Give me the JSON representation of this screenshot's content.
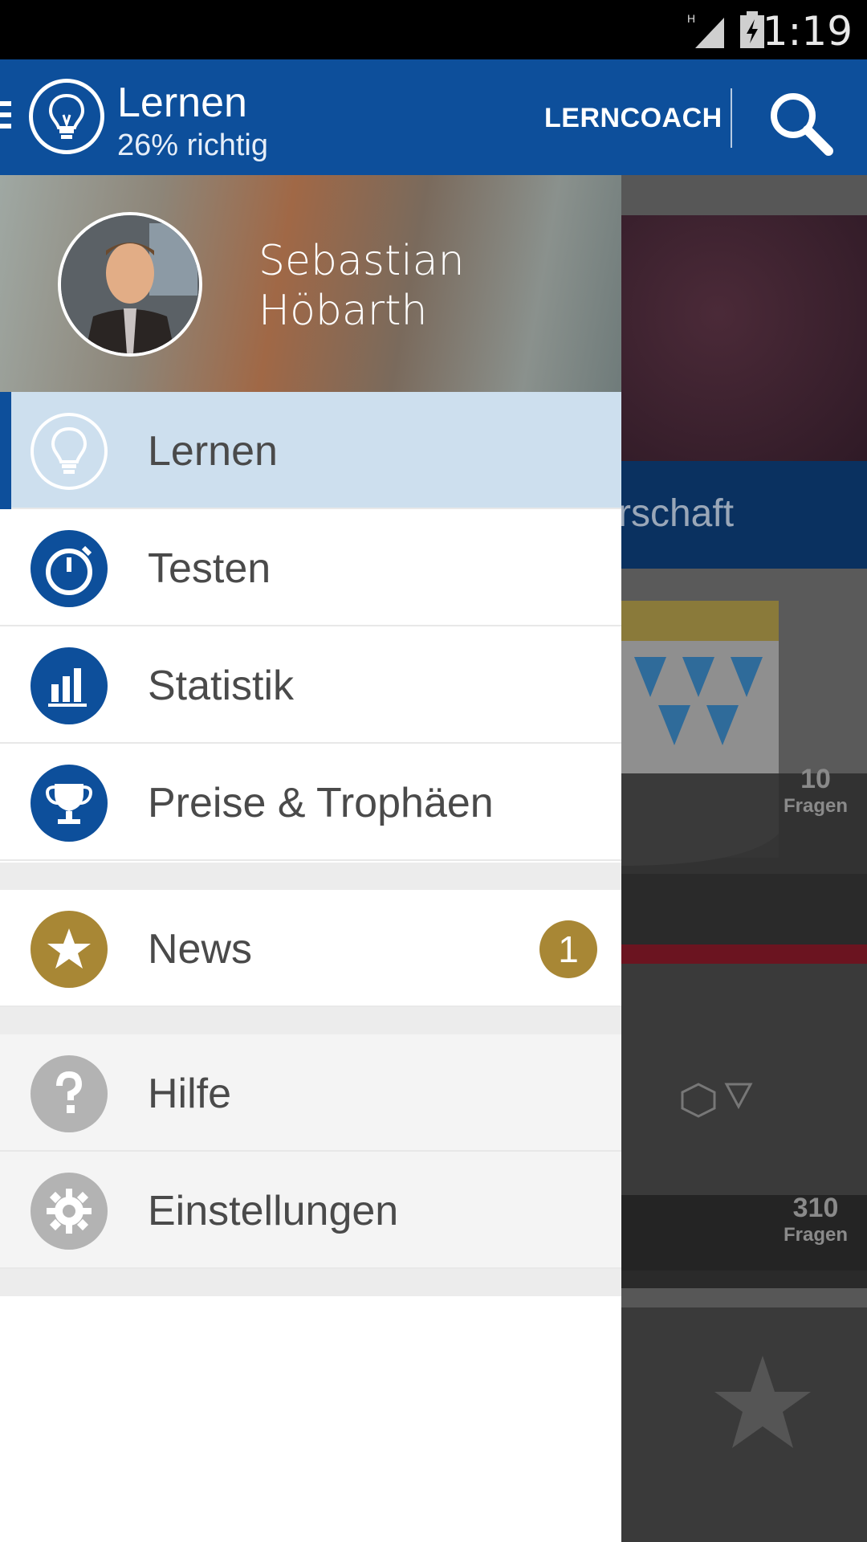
{
  "status_bar": {
    "time": "1:19",
    "network": "H"
  },
  "app_bar": {
    "title": "Lernen",
    "subtitle": "26% richtig",
    "coach_label": "LERNCOACH",
    "icon": "lightbulb-icon"
  },
  "background": {
    "category_text": "rschaft",
    "card1": {
      "count": "10",
      "unit": "Fragen"
    },
    "card2": {
      "count": "310",
      "unit": "Fragen"
    }
  },
  "drawer": {
    "profile": {
      "first_name": "Sebastian",
      "last_name": "Höbarth"
    },
    "items": [
      {
        "label": "Lernen",
        "icon": "lightbulb-icon",
        "active": true
      },
      {
        "label": "Testen",
        "icon": "stopwatch-icon"
      },
      {
        "label": "Statistik",
        "icon": "bar-chart-icon"
      },
      {
        "label": "Preise & Trophäen",
        "icon": "trophy-icon"
      },
      {
        "label": "News",
        "icon": "star-icon",
        "badge": "1"
      },
      {
        "label": "Hilfe",
        "icon": "question-icon"
      },
      {
        "label": "Einstellungen",
        "icon": "gear-icon"
      }
    ]
  },
  "colors": {
    "primary": "#0d4f9b",
    "active_bg": "#cddfee",
    "gold": "#a88735",
    "gray_icon": "#b3b3b3"
  }
}
